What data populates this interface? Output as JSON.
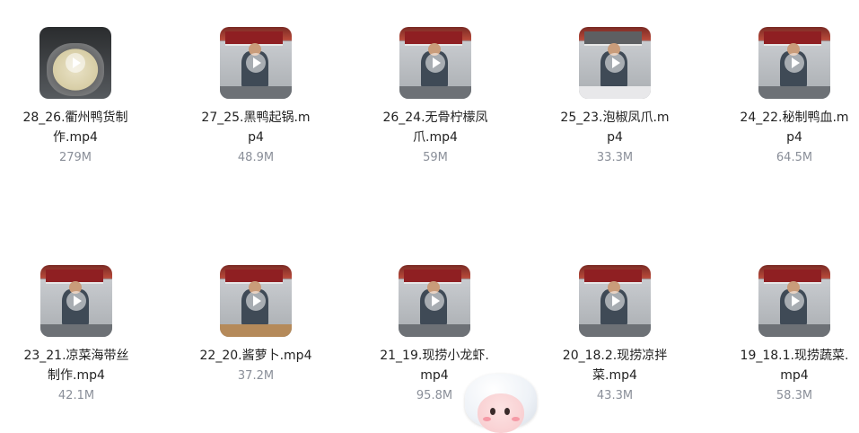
{
  "files": [
    {
      "name": "28_26.衢州鸭货制作.mp4",
      "size": "279M",
      "thumb": "pot-icon"
    },
    {
      "name": "27_25.黑鸭起锅.mp4",
      "size": "48.9M",
      "thumb": "video-thumbnail"
    },
    {
      "name": "26_24.无骨柠檬凤爪.mp4",
      "size": "59M",
      "thumb": "video-thumbnail"
    },
    {
      "name": "25_23.泡椒凤爪.mp4",
      "size": "33.3M",
      "thumb": "video-thumbnail"
    },
    {
      "name": "24_22.秘制鸭血.mp4",
      "size": "64.5M",
      "thumb": "video-thumbnail"
    },
    {
      "name": "23_21.凉菜海带丝制作.mp4",
      "size": "42.1M",
      "thumb": "video-thumbnail"
    },
    {
      "name": "22_20.酱萝卜.mp4",
      "size": "37.2M",
      "thumb": "video-thumbnail"
    },
    {
      "name": "21_19.现捞小龙虾.mp4",
      "size": "95.8M",
      "thumb": "video-thumbnail"
    },
    {
      "name": "20_18.2.现捞凉拌菜.mp4",
      "size": "43.3M",
      "thumb": "video-thumbnail"
    },
    {
      "name": "19_18.1.现捞蔬菜.mp4",
      "size": "58.3M",
      "thumb": "video-thumbnail"
    }
  ],
  "mascot": "assistant-mascot-icon"
}
